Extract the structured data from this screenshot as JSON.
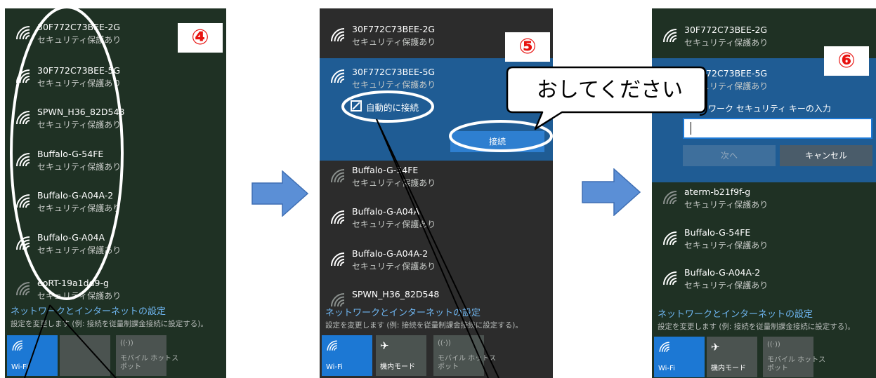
{
  "panel1": {
    "step": "④",
    "networks": [
      {
        "ssid": "30F772C73BEE-2G",
        "sec": "セキュリティ保護あり"
      },
      {
        "ssid": "30F772C73BEE-5G",
        "sec": "セキュリティ保護あり"
      },
      {
        "ssid": "SPWN_H36_82D548",
        "sec": "セキュリティ保護あり"
      },
      {
        "ssid": "Buffalo-G-54FE",
        "sec": "セキュリティ保護あり"
      },
      {
        "ssid": "Buffalo-G-A04A-2",
        "sec": "セキュリティ保護あり"
      },
      {
        "ssid": "Buffalo-G-A04A",
        "sec": "セキュリティ保護あり"
      },
      {
        "ssid": "eoRT-19a1dd9-g",
        "sec": "セキュリティ保護あり"
      }
    ],
    "settings_title": "ネットワークとインターネットの設定",
    "settings_desc": "設定を変更します (例: 接続を従量制課金接続に設定する)。",
    "tiles": [
      {
        "label": "Wi-Fi"
      },
      {
        "label": ""
      },
      {
        "label": "モバイル ホットス\nポット"
      }
    ]
  },
  "panel2": {
    "step": "⑤",
    "networks_top": [
      {
        "ssid": "30F772C73BEE-2G",
        "sec": "セキュリティ保護あり"
      }
    ],
    "selected": {
      "ssid": "30F772C73BEE-5G",
      "sec": "セキュリティ保護あり",
      "auto_connect_label": "自動的に接続",
      "connect_label": "接続"
    },
    "networks_bottom": [
      {
        "ssid": "Buffalo-G-54FE",
        "sec": "セキュリティ保護あり"
      },
      {
        "ssid": "Buffalo-G-A04A",
        "sec": "セキュリティ保護あり"
      },
      {
        "ssid": "Buffalo-G-A04A-2",
        "sec": "セキュリティ保護あり"
      },
      {
        "ssid": "SPWN_H36_82D548",
        "sec": ""
      }
    ],
    "settings_title": "ネットワークとインターネットの設定",
    "settings_desc": "設定を変更します (例: 接続を従量制課金接続に設定する)。",
    "tiles": [
      {
        "label": "Wi-Fi"
      },
      {
        "label": "機内モード"
      },
      {
        "label": "モバイル ホットス\nポット"
      }
    ],
    "callout": "おしてください"
  },
  "panel3": {
    "step": "⑥",
    "networks_top": [
      {
        "ssid": "30F772C73BEE-2G",
        "sec": "セキュリティ保護あり"
      }
    ],
    "selected": {
      "ssid": "30F772C73BEE-5G",
      "sec": "セキュリティ保護あり",
      "key_label": "ネットワーク セキュリティ キーの入力",
      "key_value": "",
      "next_label": "次へ",
      "cancel_label": "キャンセル"
    },
    "networks_bottom": [
      {
        "ssid": "aterm-b21f9f-g",
        "sec": "セキュリティ保護あり"
      },
      {
        "ssid": "Buffalo-G-54FE",
        "sec": "セキュリティ保護あり"
      },
      {
        "ssid": "Buffalo-G-A04A-2",
        "sec": "セキュリティ保護あり"
      }
    ],
    "settings_title": "ネットワークとインターネットの設定",
    "settings_desc": "設定を変更します (例: 接続を従量制課金接続に設定する)。",
    "tiles": [
      {
        "label": "Wi-Fi"
      },
      {
        "label": "機内モード"
      },
      {
        "label": "モバイル ホットス\nポット"
      }
    ]
  },
  "colors": {
    "accent": "#1c78d4",
    "selected_bg": "#1f5c94",
    "badge_text": "#e8120f",
    "arrow": "#5b8fd6",
    "link": "#6fb7f3"
  }
}
